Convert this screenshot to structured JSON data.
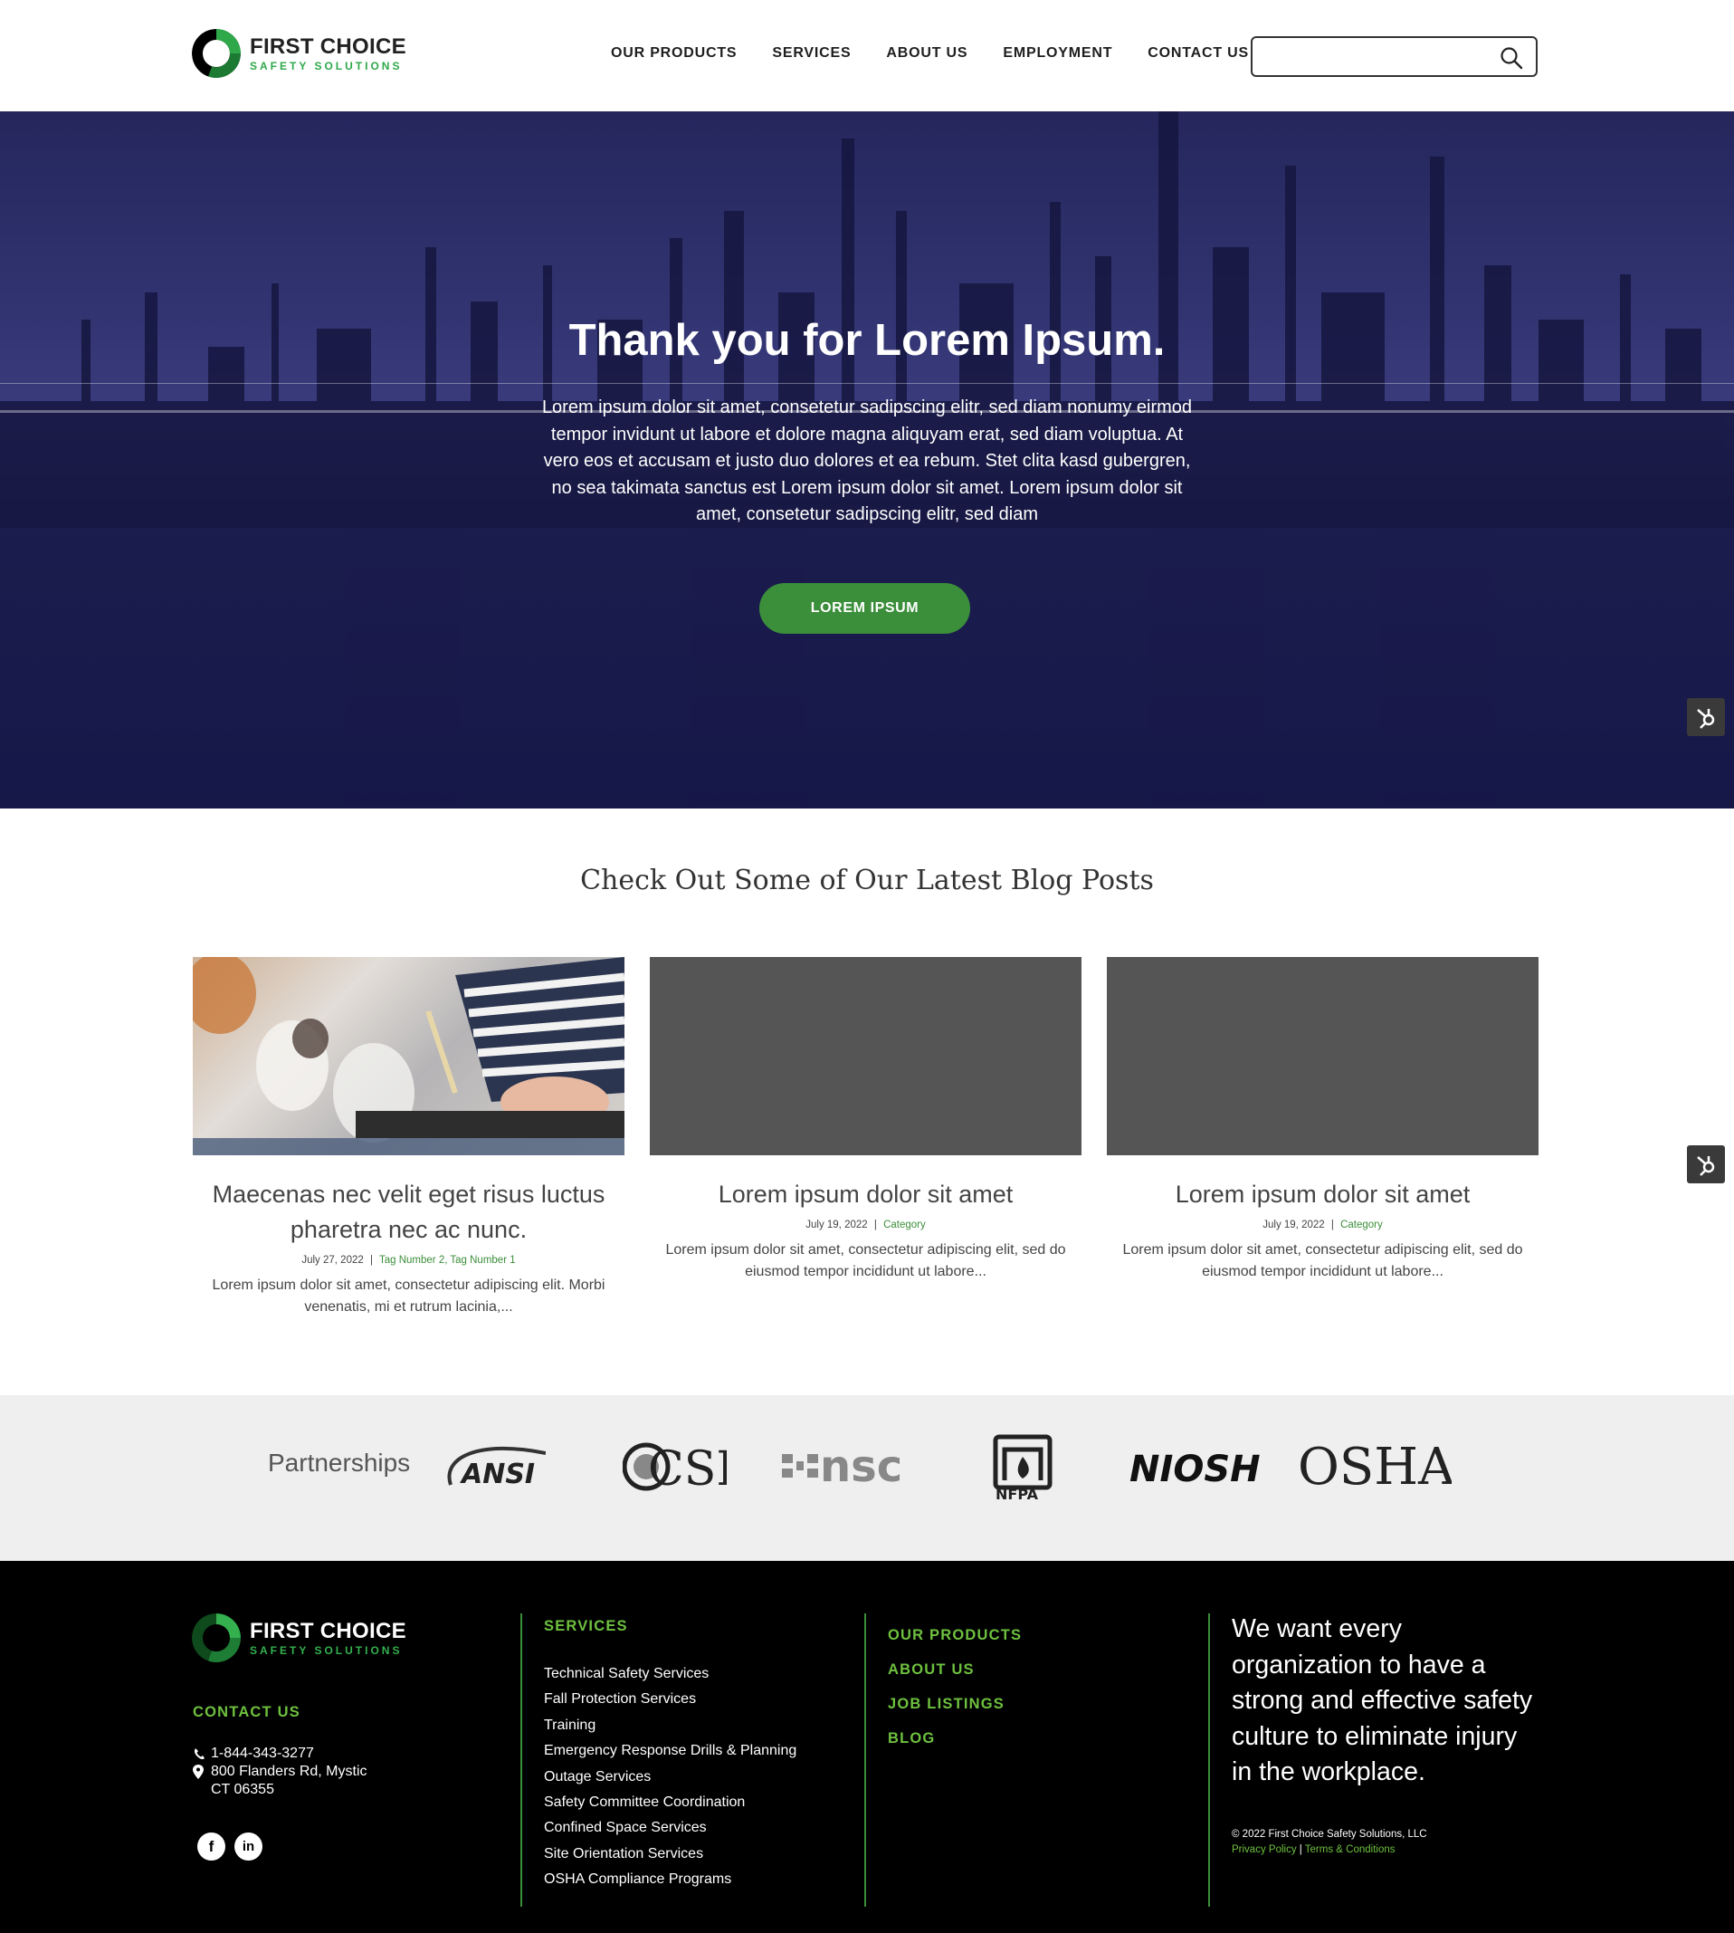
{
  "brand": {
    "name": "FIRST CHOICE",
    "sub": "SAFETY SOLUTIONS",
    "green": "#3b8e3a",
    "lime": "#6ec13f"
  },
  "nav": {
    "items": [
      "OUR PRODUCTS",
      "SERVICES",
      "ABOUT US",
      "EMPLOYMENT",
      "CONTACT US"
    ],
    "search_value": ""
  },
  "hero": {
    "title": "Thank you for Lorem Ipsum.",
    "body": "Lorem ipsum dolor sit amet, consetetur sadipscing elitr, sed diam nonumy eirmod tempor invidunt ut labore et dolore magna aliquyam erat, sed diam voluptua. At vero eos et accusam et justo duo dolores et ea rebum. Stet clita kasd gubergren, no sea takimata sanctus est Lorem ipsum dolor sit amet. Lorem ipsum dolor sit amet, consetetur sadipscing elitr, sed diam",
    "button": "LOREM IPSUM"
  },
  "blog": {
    "heading": "Check Out Some of Our Latest Blog Posts",
    "posts": [
      {
        "title": "Maecenas nec velit eget risus luctus pharetra nec ac nunc.",
        "date": "July 27, 2022",
        "sep": "|",
        "tags": "Tag Number 2, Tag Number 1",
        "excerpt": "Lorem ipsum dolor sit amet, consectetur adipiscing elit. Morbi venenatis, mi et rutrum lacinia,..."
      },
      {
        "title": "Lorem ipsum dolor sit amet",
        "date": "July 19, 2022",
        "sep": "|",
        "tags": "Category",
        "excerpt": "Lorem ipsum dolor sit amet, consectetur adipiscing elit, sed do eiusmod tempor incididunt ut labore..."
      },
      {
        "title": "Lorem ipsum dolor sit amet",
        "date": "July 19, 2022",
        "sep": "|",
        "tags": "Category",
        "excerpt": "Lorem ipsum dolor sit amet, consectetur adipiscing elit, sed do eiusmod tempor incididunt ut labore..."
      }
    ]
  },
  "partnerships": {
    "label": "Partnerships",
    "logos": {
      "ansi": "ANSI",
      "csb": "CSB",
      "nsc": "nsc",
      "nfpa": "NFPA",
      "niosh": "NIOSH",
      "osha": "OSHA"
    }
  },
  "footer": {
    "contact_heading": "CONTACT US",
    "phone": "1-844-343-3277",
    "address1": "800 Flanders Rd, Mystic",
    "address2": "CT 06355",
    "services_heading": "SERVICES",
    "services": [
      "Technical Safety Services",
      "Fall Protection Services",
      "Training",
      "Emergency Response Drills & Planning",
      "Outage Services",
      "Safety Committee Coordination",
      "Confined Space Services",
      "Site Orientation Services",
      "OSHA Compliance Programs"
    ],
    "links": [
      "OUR PRODUCTS",
      "ABOUT US",
      "JOB LISTINGS",
      "BLOG"
    ],
    "tagline": "We want every organization to have a strong and effective safety culture to eliminate injury in the workplace.",
    "copyright": "© 2022 First Choice Safety Solutions, LLC",
    "privacy": "Privacy Policy",
    "bar": "|",
    "terms": "Terms & Conditions",
    "social": {
      "facebook": "f",
      "linkedin": "in"
    }
  }
}
